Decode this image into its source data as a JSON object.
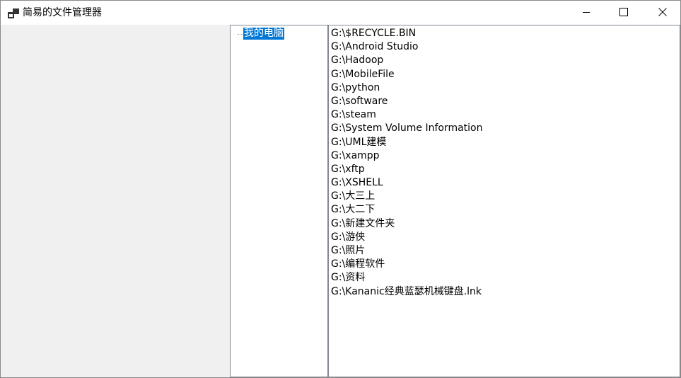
{
  "window": {
    "title": "简易的文件管理器"
  },
  "tree": {
    "root_label": "我的电脑"
  },
  "files": [
    "G:\\$RECYCLE.BIN",
    "G:\\Android Studio",
    "G:\\Hadoop",
    "G:\\MobileFile",
    "G:\\python",
    "G:\\software",
    "G:\\steam",
    "G:\\System Volume Information",
    "G:\\UML建模",
    "G:\\xampp",
    "G:\\xftp",
    "G:\\XSHELL",
    "G:\\大三上",
    "G:\\大二下",
    "G:\\新建文件夹",
    "G:\\游侠",
    "G:\\照片",
    "G:\\编程软件",
    "G:\\资料",
    "G:\\Kananic经典蓝瑟机械键盘.lnk"
  ],
  "icons": {
    "app": "app-window-icon",
    "minimize": "minimize-icon",
    "maximize": "maximize-icon",
    "close": "close-icon"
  },
  "colors": {
    "selection": "#0078d7",
    "panel_background": "#f0f0f0"
  }
}
